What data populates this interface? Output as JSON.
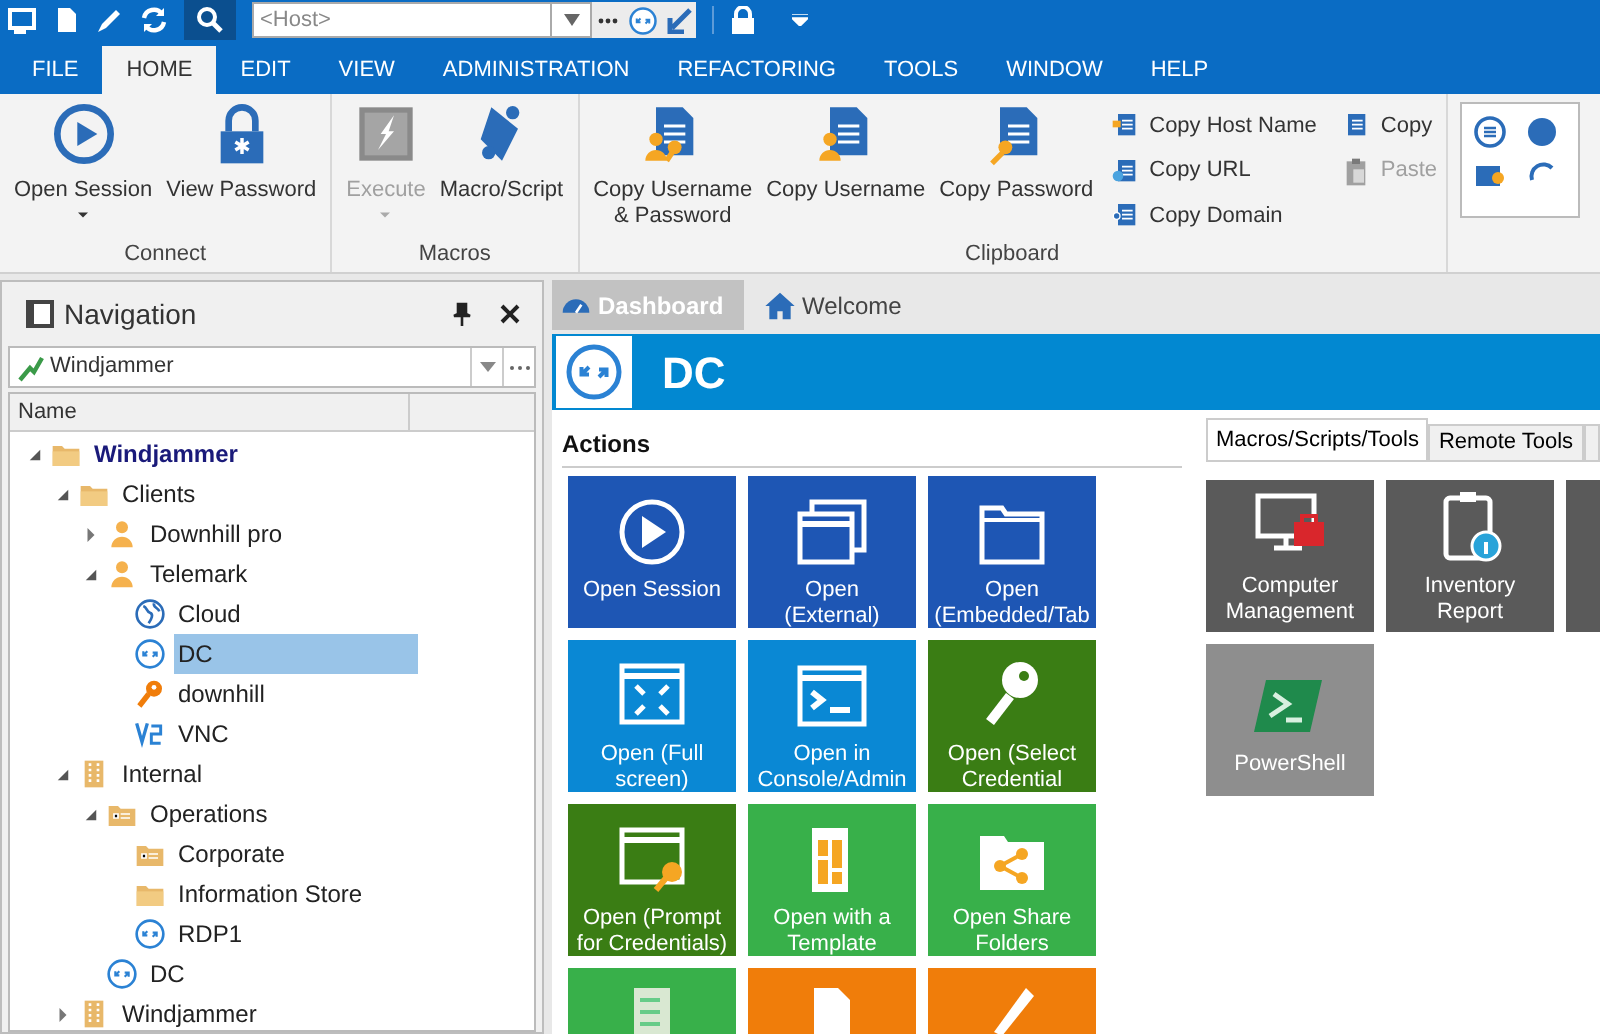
{
  "quick_access": {
    "host_field": {
      "placeholder": "<Host>"
    }
  },
  "menu_tabs": [
    {
      "label": "FILE",
      "selected": false
    },
    {
      "label": "HOME",
      "selected": true
    },
    {
      "label": "EDIT",
      "selected": false
    },
    {
      "label": "VIEW",
      "selected": false
    },
    {
      "label": "ADMINISTRATION",
      "selected": false
    },
    {
      "label": "REFACTORING",
      "selected": false
    },
    {
      "label": "TOOLS",
      "selected": false
    },
    {
      "label": "WINDOW",
      "selected": false
    },
    {
      "label": "HELP",
      "selected": false
    }
  ],
  "ribbon": {
    "groups": [
      {
        "title": "Connect",
        "buttons": [
          {
            "label": "Open Session",
            "kind": "play",
            "dropdown": true,
            "disabled": false
          },
          {
            "label": "View Password",
            "kind": "lock",
            "dropdown": false,
            "disabled": false
          }
        ]
      },
      {
        "title": "Macros",
        "buttons": [
          {
            "label": "Execute",
            "kind": "execute",
            "dropdown": true,
            "disabled": true
          },
          {
            "label": "Macro/Script",
            "kind": "scroll",
            "dropdown": false,
            "disabled": false
          }
        ]
      },
      {
        "title": "Clipboard",
        "buttons": [
          {
            "label": "Copy Username\n& Password",
            "kind": "doc-user-key",
            "dropdown": false,
            "disabled": false
          },
          {
            "label": "Copy Username",
            "kind": "doc-user",
            "dropdown": false,
            "disabled": false
          },
          {
            "label": "Copy Password",
            "kind": "doc-key",
            "dropdown": false,
            "disabled": false
          }
        ],
        "small_buttons": [
          {
            "label": "Copy Host Name",
            "kind": "host",
            "disabled": false
          },
          {
            "label": "Copy URL",
            "kind": "url",
            "disabled": false
          },
          {
            "label": "Copy Domain",
            "kind": "domain",
            "disabled": false
          },
          {
            "label": "Copy",
            "kind": "copy",
            "disabled": false
          },
          {
            "label": "Paste",
            "kind": "paste",
            "disabled": true
          }
        ]
      }
    ]
  },
  "navigation": {
    "title": "Navigation",
    "vault": "Windjammer",
    "column_1": "Name",
    "tree": [
      {
        "label": "Windjammer",
        "kind": "folder",
        "bold": true,
        "expanded": true,
        "selected": false,
        "children": [
          {
            "label": "Clients",
            "kind": "folder",
            "expanded": true,
            "selected": false,
            "children": [
              {
                "label": "Downhill pro",
                "kind": "user",
                "expanded": false,
                "selected": false
              },
              {
                "label": "Telemark",
                "kind": "user",
                "expanded": true,
                "selected": false,
                "children": [
                  {
                    "label": "Cloud",
                    "kind": "globe",
                    "selected": false
                  },
                  {
                    "label": "DC",
                    "kind": "rdp",
                    "selected": true
                  },
                  {
                    "label": "downhill",
                    "kind": "key",
                    "selected": false
                  },
                  {
                    "label": "VNC",
                    "kind": "vnc",
                    "selected": false
                  }
                ]
              }
            ]
          },
          {
            "label": "Internal",
            "kind": "building",
            "expanded": true,
            "selected": false,
            "children": [
              {
                "label": "Operations",
                "kind": "card-folder",
                "expanded": true,
                "selected": false,
                "children": [
                  {
                    "label": "Corporate",
                    "kind": "card-folder",
                    "selected": false
                  },
                  {
                    "label": "Information Store",
                    "kind": "folder",
                    "selected": false
                  },
                  {
                    "label": "RDP1",
                    "kind": "rdp",
                    "selected": false
                  }
                ]
              },
              {
                "label": "DC",
                "kind": "rdp",
                "selected": false
              }
            ]
          },
          {
            "label": "Windjammer",
            "kind": "building",
            "expanded": false,
            "selected": false
          }
        ]
      }
    ]
  },
  "document_tabs": [
    {
      "label": "Dashboard",
      "kind": "dashboard",
      "selected": true
    },
    {
      "label": "Welcome",
      "kind": "home",
      "selected": false
    }
  ],
  "entry": {
    "title": "DC"
  },
  "actions": {
    "title": "Actions",
    "tiles": [
      {
        "label": "Open Session",
        "kind": "play",
        "color": "#1e56b4"
      },
      {
        "label": "Open\n(External)",
        "kind": "windows",
        "color": "#1e56b4"
      },
      {
        "label": "Open\n(Embedded/Tab",
        "kind": "folder",
        "color": "#1e56b4"
      },
      {
        "label": "Open (Full\nscreen)",
        "kind": "fullscreen",
        "color": "#0a88d4"
      },
      {
        "label": "Open in\nConsole/Admin",
        "kind": "console",
        "color": "#0a88d4"
      },
      {
        "label": "Open (Select\nCredential",
        "kind": "key",
        "color": "#3a7d14"
      },
      {
        "label": "Open (Prompt\nfor Credentials)",
        "kind": "window-key",
        "color": "#3a7d14"
      },
      {
        "label": "Open with a\nTemplate",
        "kind": "template",
        "color": "#38b04a"
      },
      {
        "label": "Open Share\nFolders",
        "kind": "share",
        "color": "#38b04a"
      },
      {
        "kind": "checklist",
        "color": "#38b04a"
      },
      {
        "kind": "page",
        "color": "#f07d0a"
      },
      {
        "kind": "pencil",
        "color": "#f07d0a"
      }
    ]
  },
  "tools": {
    "tabs": [
      {
        "label": "Macros/Scripts/Tools",
        "selected": true
      },
      {
        "label": "Remote Tools",
        "selected": false
      }
    ],
    "tiles": [
      {
        "label": "Computer\nManagement",
        "kind": "computer",
        "selected": false
      },
      {
        "label": "Inventory\nReport",
        "kind": "report",
        "selected": false
      },
      {
        "kind": "blank",
        "selected": false
      },
      {
        "label": "PowerShell",
        "kind": "powershell",
        "selected": true
      }
    ]
  }
}
